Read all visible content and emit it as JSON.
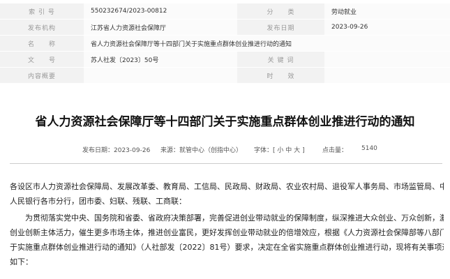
{
  "meta": {
    "index_label": "索 引 号",
    "index_value": "550232674/2023-00812",
    "category_label": "分　　类",
    "category_value": "劳动就业",
    "publisher_label": "发布机构",
    "publisher_value": "江苏省人力资源社会保障厅",
    "date_label": "发布日期",
    "date_value": "2023-09-26",
    "name_label": "名　　称",
    "name_value": "省人力资源社会保障厅等十四部门关于实施重点群体创业推进行动的通知",
    "docno_label": "文　　号",
    "docno_value": "苏人社发〔2023〕50号",
    "keywords_label": "关 键 词",
    "keywords_value": "",
    "summary_label": "内容概要",
    "summary_value": "",
    "validity_label": "时　　效",
    "validity_value": ""
  },
  "article": {
    "title": "省人力资源社会保障厅等十四部门关于实施重点群体创业推进行动的通知",
    "publish_date_text": "发布日期：2023-09-26",
    "source_text": "来源：就管中心（创指中心）",
    "font_size_label": "字体：[",
    "font_small": "小",
    "font_medium": "中",
    "font_large": "大",
    "font_size_close": "]",
    "views_label": "点击量：",
    "views_value": "5140",
    "paragraph1_lines": [
      "各设区市人力资源社会保障局、发展改革委、教育局、工信局、民政局、财政局、农业农村局、退役军人事务局、市场监管局、中国",
      "人民银行各市分行，团市委、妇联、残联、工商联："
    ],
    "paragraph2_lines": [
      "为贯彻落实党中央、国务院和省委、省政府决策部署，完善促进创业带动就业的保障制度，纵深推进大众创业、万众创新，激发",
      "创业创新主体活力，催生更多市场主体，推进创业富民，更好发挥创业带动就业的倍增效应，根据《人力资源社会保障部等八部门关",
      "于实施重点群体创业推进行动的通知》（人社部发〔2022〕81号）要求，决定在全省实施重点群体创业推进行动，现将有关事项通知",
      "如下："
    ]
  }
}
